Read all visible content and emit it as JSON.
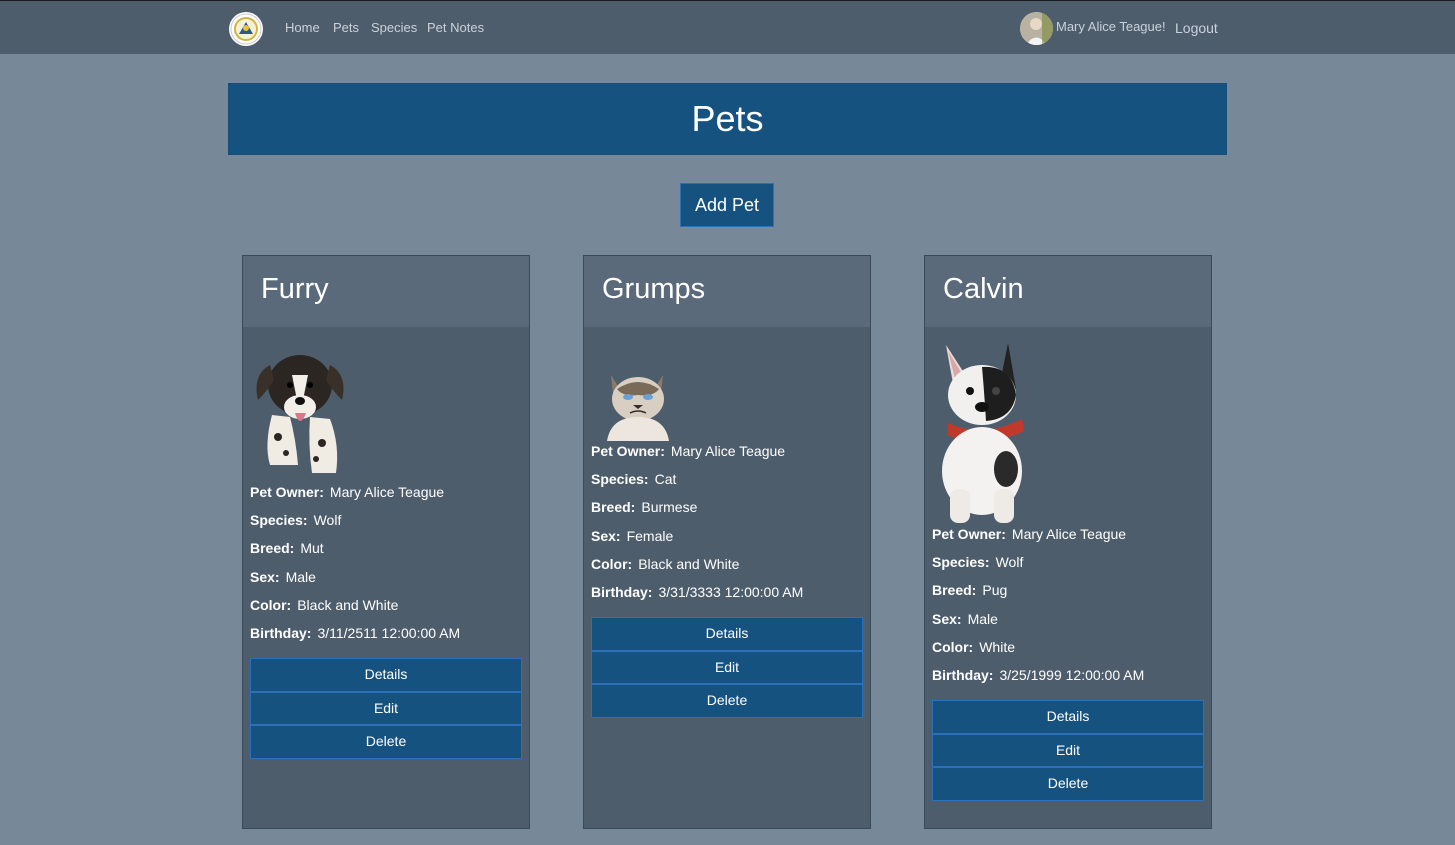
{
  "nav": {
    "home": "Home",
    "pets": "Pets",
    "species": "Species",
    "pet_notes": "Pet Notes",
    "user_greeting": "Mary Alice Teague!",
    "logout": "Logout"
  },
  "page": {
    "title": "Pets",
    "add_pet": "Add Pet"
  },
  "labels": {
    "owner": "Pet Owner:",
    "species": "Species:",
    "breed": "Breed:",
    "sex": "Sex:",
    "color": "Color:",
    "birthday": "Birthday:",
    "details": "Details",
    "edit": "Edit",
    "delete": "Delete"
  },
  "pets": [
    {
      "name": "Furry",
      "owner": "Mary Alice Teague",
      "species": "Wolf",
      "breed": "Mut",
      "sex": "Male",
      "color": "Black and White",
      "birthday": "3/11/2511 12:00:00 AM",
      "image_icon": "dog-icon"
    },
    {
      "name": "Grumps",
      "owner": "Mary Alice Teague",
      "species": "Cat",
      "breed": "Burmese",
      "sex": "Female",
      "color": "Black and White",
      "birthday": "3/31/3333 12:00:00 AM",
      "image_icon": "cat-icon"
    },
    {
      "name": "Calvin",
      "owner": "Mary Alice Teague",
      "species": "Wolf",
      "breed": "Pug",
      "sex": "Male",
      "color": "White",
      "birthday": "3/25/1999 12:00:00 AM",
      "image_icon": "bulldog-icon"
    }
  ],
  "colors": {
    "background": "#778899",
    "navbar": "#4e5d6c",
    "primary": "#15527f",
    "card_header": "#5a6a7a"
  }
}
